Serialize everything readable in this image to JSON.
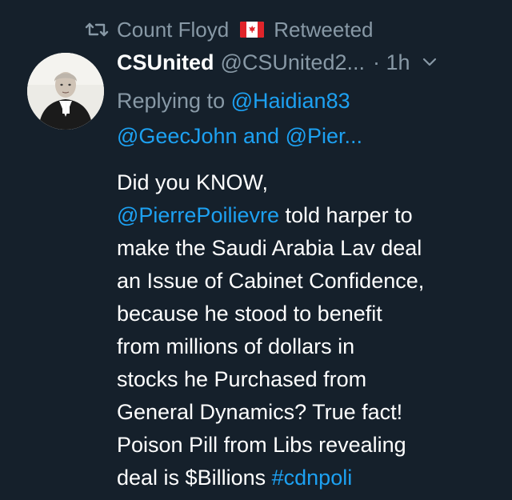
{
  "retweet_bar": {
    "retweeter": "Count Floyd",
    "label": "Retweeted",
    "flag_icon": "canada-flag-icon"
  },
  "tweet": {
    "display_name": "CSUnited",
    "handle": "@CSUnited2...",
    "time": "· 1h",
    "reply_prefix": "Replying to",
    "reply_to_1": "@Haidian83",
    "reply_to_2": "@GeecJohn",
    "reply_and": "and",
    "reply_to_3": "@Pier...",
    "body_line1": "Did you KNOW,",
    "body_mention": "@PierrePoilievre",
    "body_after_mention": "told harper to",
    "body_lines": [
      "make the Saudi Arabia Lav deal",
      "an Issue of Cabinet Confidence,",
      "because he stood to benefit",
      "from millions of dollars in",
      "stocks he Purchased from",
      "General Dynamics? True fact!",
      "Poison Pill from Libs revealing"
    ],
    "body_last_prefix": "deal is $Billions",
    "body_hashtag": "#cdnpoli"
  },
  "colors": {
    "background": "#15202b",
    "secondary_text": "#8899a6",
    "link": "#1da1f2",
    "primary_text": "#ffffff"
  }
}
